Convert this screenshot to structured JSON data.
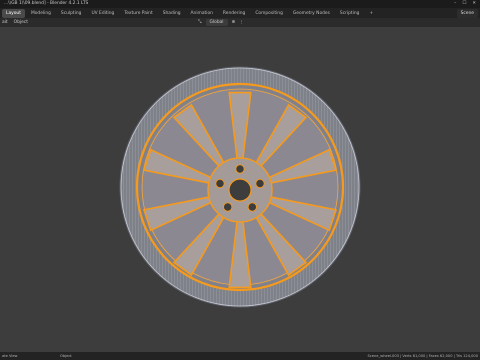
{
  "window": {
    "title": "...\\\\GB 1\\\\09.blend] - Blender 4.2.1 LTS",
    "controls": {
      "minimize": "–",
      "maximize": "☐",
      "close": "✕"
    }
  },
  "workspace_tabs": [
    {
      "label": "Layout",
      "active": true
    },
    {
      "label": "Modeling"
    },
    {
      "label": "Sculpting"
    },
    {
      "label": "UV Editing"
    },
    {
      "label": "Texture Paint"
    },
    {
      "label": "Shading"
    },
    {
      "label": "Animation"
    },
    {
      "label": "Rendering"
    },
    {
      "label": "Compositing"
    },
    {
      "label": "Geometry Nodes"
    },
    {
      "label": "Scripting"
    },
    {
      "label": "+"
    }
  ],
  "scene_selector": "Scene",
  "viewport_header": {
    "left_items": [
      "ait",
      "Object"
    ],
    "transform_orientation": "Global"
  },
  "status_bar": {
    "left": "ate View",
    "middle": "Object",
    "right": "Scene_wheel.003 | Verts 61,000 | Faces 62,000 | Tris 124,000"
  },
  "colors": {
    "wire_accent": "#f59a1c",
    "mesh_fill": "#8f8f99",
    "rim_shade": "#7d7f8a"
  },
  "icons": {
    "cursor": "cursor-icon",
    "orientation": "orientation-icon",
    "grid": "grid-icon"
  }
}
